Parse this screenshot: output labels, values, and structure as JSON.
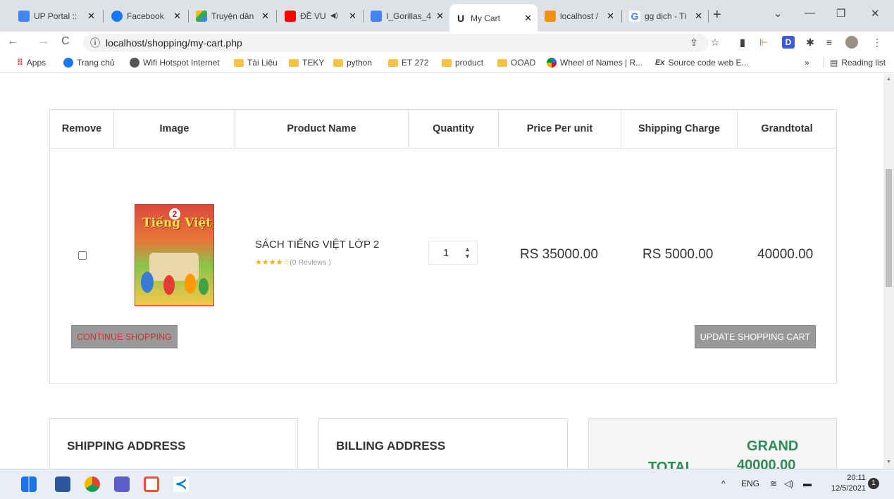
{
  "browser": {
    "tabs": [
      {
        "label": "UP Portal ::",
        "icon": "up-portal-icon",
        "color": "#4285f4"
      },
      {
        "label": "Facebook",
        "icon": "facebook-icon",
        "color": "#1877f2"
      },
      {
        "label": "Truyện dân",
        "icon": "google-drive-icon",
        "color": "#34a853"
      },
      {
        "label": "ĐỀ VU",
        "icon": "youtube-icon",
        "color": "#ff0000"
      },
      {
        "label": "I_Gorillas_4",
        "icon": "google-docs-icon",
        "color": "#4285f4"
      },
      {
        "label": "My Cart",
        "icon": "site-u-icon",
        "color": "#222222"
      },
      {
        "label": "localhost /",
        "icon": "phpmyadmin-icon",
        "color": "#f29111"
      },
      {
        "label": "gg dịch - Tì",
        "icon": "google-icon",
        "color": "#4285f4"
      }
    ],
    "close_glyph": "✕",
    "new_tab_glyph": "+",
    "window_controls": {
      "dropdown": "⌄",
      "minimize": "—",
      "restore": "❐",
      "close": "✕"
    },
    "nav": {
      "back": "←",
      "forward": "→",
      "reload": "C"
    },
    "url": "localhost/shopping/my-cart.php",
    "url_info_glyph": "ⓘ",
    "bookmarks": [
      {
        "label": "Apps",
        "type": "apps"
      },
      {
        "label": "Trang chủ",
        "type": "facebook"
      },
      {
        "label": "Wifi Hotspot Internet",
        "type": "globe"
      },
      {
        "label": "Tài Liệu",
        "type": "folder"
      },
      {
        "label": "TEKY",
        "type": "folder"
      },
      {
        "label": "python",
        "type": "folder"
      },
      {
        "label": "ET 272",
        "type": "folder"
      },
      {
        "label": "product",
        "type": "folder"
      },
      {
        "label": "OOAD",
        "type": "folder"
      },
      {
        "label": "Wheel of Names | R...",
        "type": "wheel"
      },
      {
        "label": "Source code web E...",
        "type": "ex"
      }
    ],
    "bookmarks_overflow": "»",
    "reading_list": "Reading list"
  },
  "cart": {
    "headers": [
      "Remove",
      "Image",
      "Product Name",
      "Quantity",
      "Price Per unit",
      "Shipping Charge",
      "Grandtotal"
    ],
    "item": {
      "name": "SÁCH TIẾNG VIỆT LỚP 2",
      "rating": 4,
      "stars_text": "★★★★☆",
      "reviews": "(0 Reviews )",
      "quantity": "1",
      "price": "RS 35000.00",
      "shipping": "RS 5000.00",
      "grandtotal": "40000.00",
      "book_title": "Tiếng Việt",
      "book_number": "2"
    },
    "continue_label": "CONTINUE SHOPPING",
    "update_label": "UPDATE SHOPPING CART"
  },
  "addresses": {
    "shipping_title": "SHIPPING ADDRESS",
    "billing_title": "BILLING ADDRESS",
    "grand_label": "GRAND",
    "total_label": "TOTAL",
    "grand_value": "40000.00"
  },
  "taskbar": {
    "tray_lang": "ENG",
    "time": "20:11",
    "date": "12/5/2021",
    "notifications": "1",
    "chevron": "^"
  },
  "colors": {
    "accent_green": "#2e8b57",
    "button_gray": "#999999",
    "continue_red": "#cc3333"
  }
}
